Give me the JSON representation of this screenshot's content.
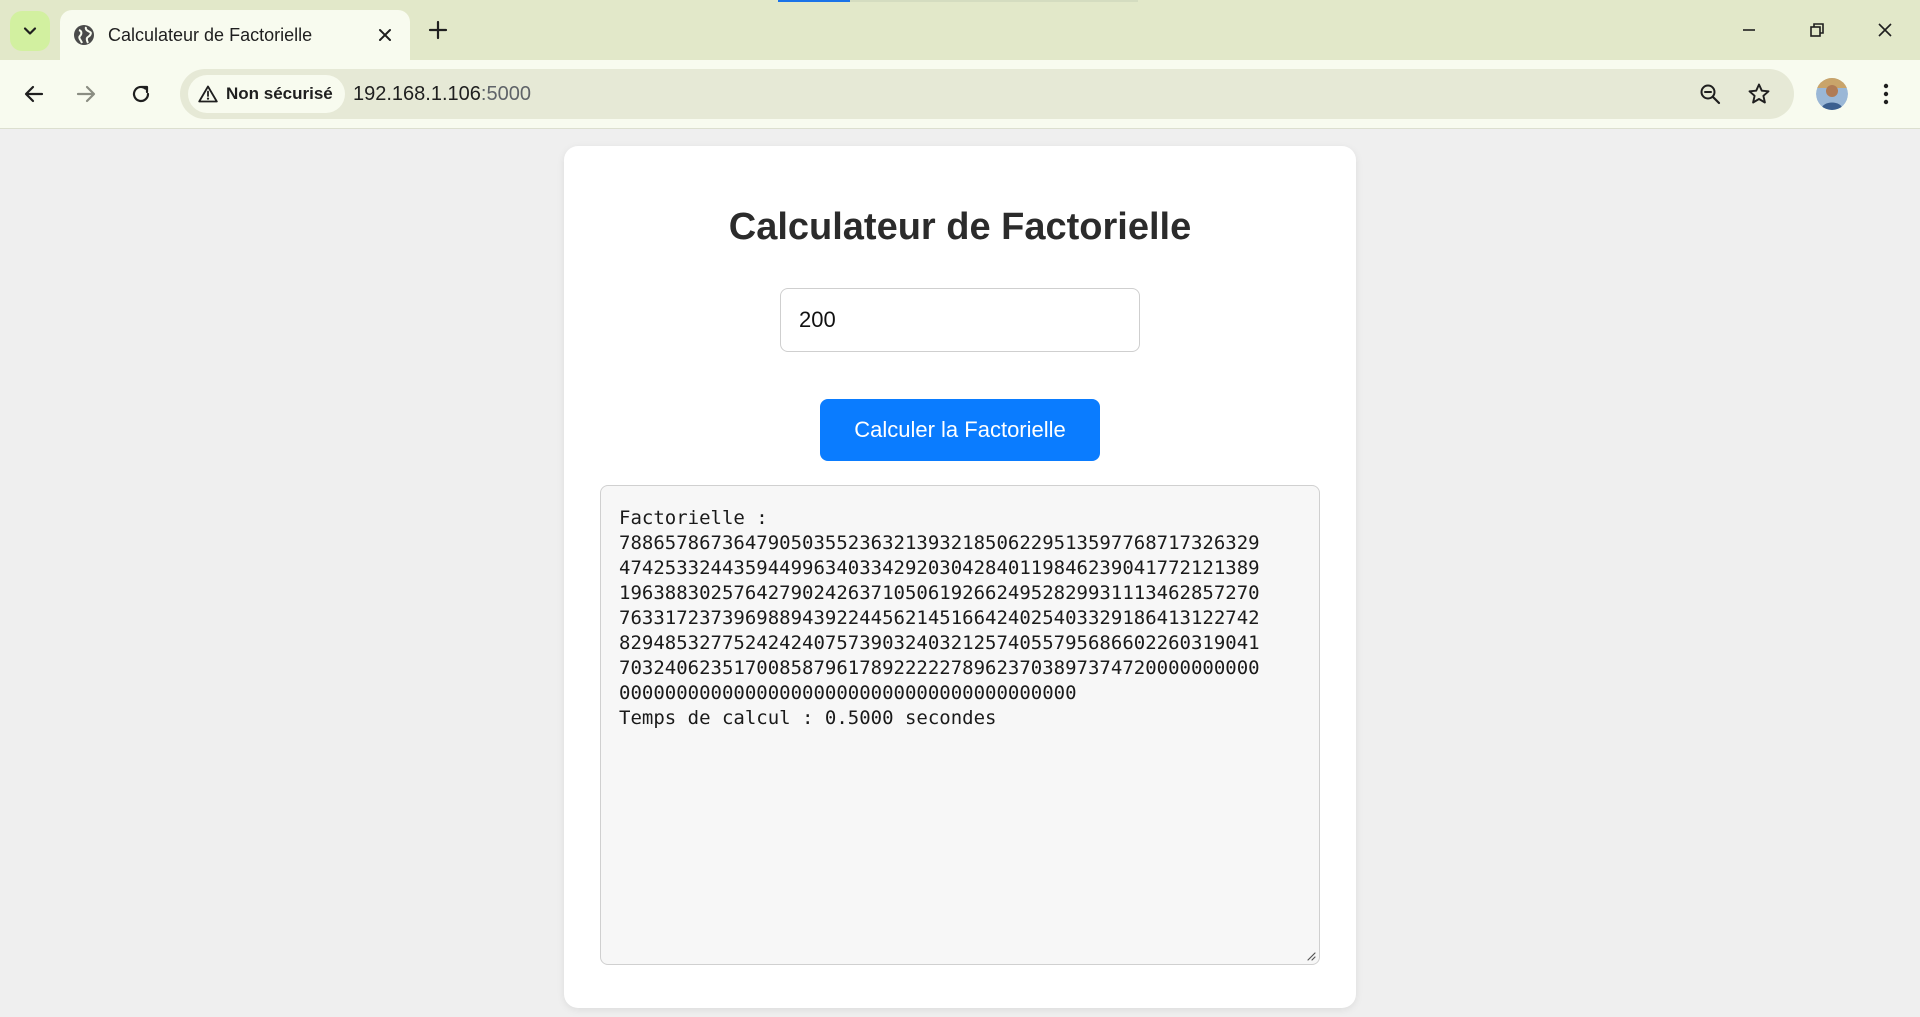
{
  "browser": {
    "tab": {
      "title": "Calculateur de Factorielle"
    },
    "loading_progress": 0.2,
    "address_bar": {
      "security_label": "Non sécurisé",
      "url_host": "192.168.1.106",
      "url_port": ":5000"
    },
    "icons": {
      "tab_search": "chevron-down-icon",
      "favicon": "globe-icon",
      "tab_close": "close-icon",
      "new_tab": "plus-icon",
      "minimize": "minimize-icon",
      "restore": "restore-icon",
      "close_window": "close-icon",
      "back": "arrow-left-icon",
      "forward": "arrow-right-icon",
      "reload": "reload-icon",
      "warning": "warning-icon",
      "zoom": "zoom-out-icon",
      "bookmark": "star-icon",
      "menu": "kebab-menu-icon"
    },
    "colors": {
      "frame": "#e2e8c9",
      "toolbar": "#f8fbef",
      "accent": "#1a73e8"
    }
  },
  "page": {
    "title": "Calculateur de Factorielle",
    "input_value": "200",
    "button_label": "Calculer la Factorielle",
    "button_color": "#0a7cff",
    "result_lines": [
      "Factorielle :",
      "78865786736479050355236321393218506229513597768717326329",
      "47425332443594499634033429203042840119846239041772121389",
      "19638830257642790242637105061926624952829931113462857270",
      "76331723739698894392244562145166424025403329186413122742",
      "82948532775242424075739032403212574055795686602260319041",
      "70324062351700858796178922222789623703897374720000000000",
      "0000000000000000000000000000000000000000",
      "Temps de calcul : 0.5000 secondes"
    ]
  }
}
